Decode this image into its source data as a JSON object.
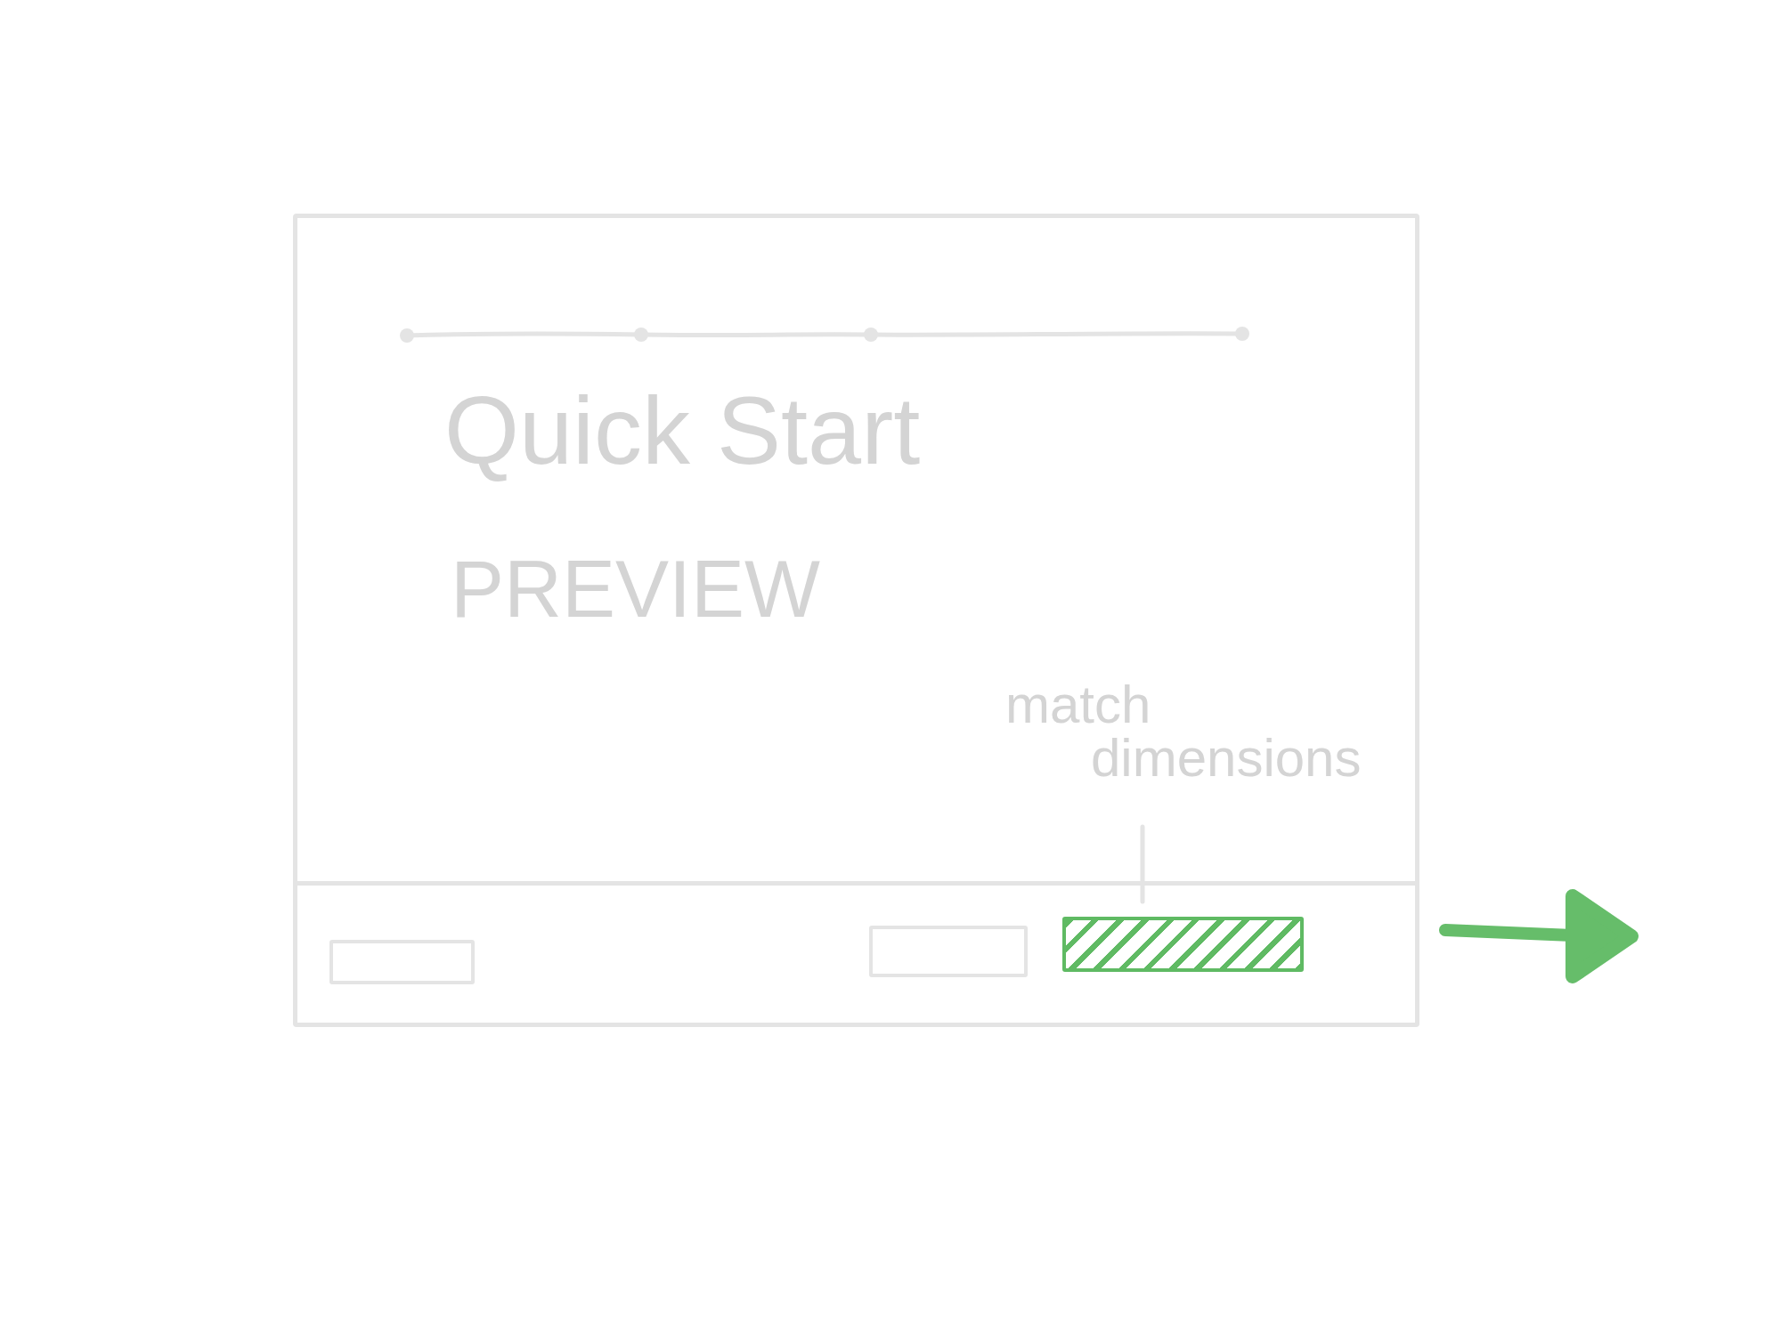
{
  "dialog": {
    "title": "Quick Start",
    "subtitle": "PREVIEW",
    "annotation": "match dimensions",
    "footer_buttons": [
      {
        "kind": "plain"
      },
      {
        "kind": "plain"
      },
      {
        "kind": "primary"
      }
    ]
  }
}
